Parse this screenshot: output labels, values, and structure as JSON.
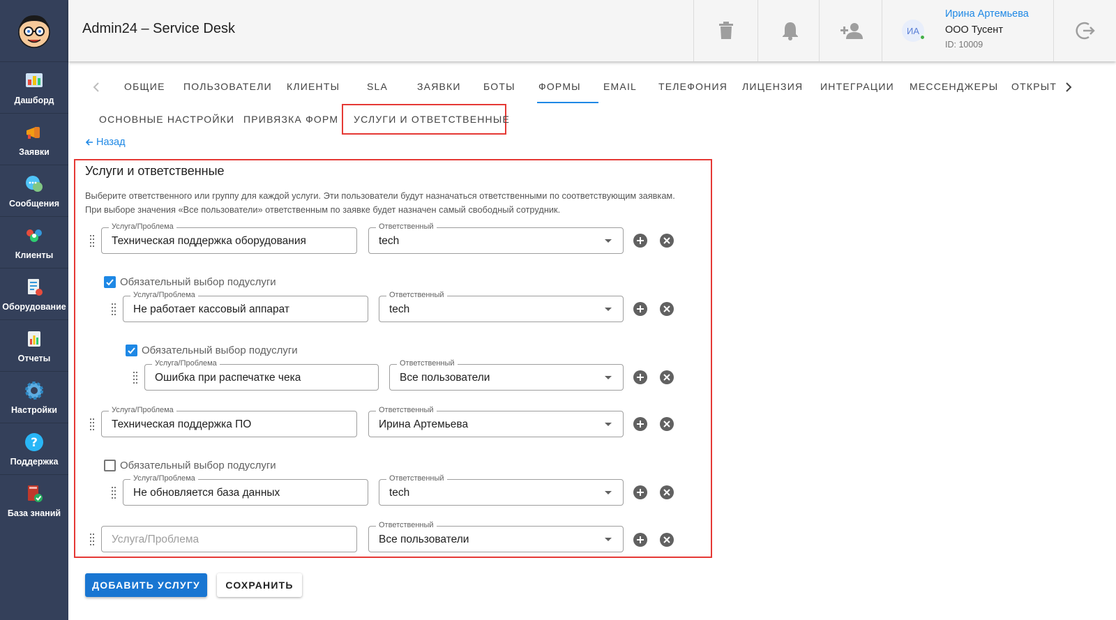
{
  "header": {
    "title": "Admin24 – Service Desk",
    "user": {
      "initials": "ИА",
      "name": "Ирина Артемьева",
      "org": "ООО Тусент",
      "id": "ID: 10009"
    }
  },
  "sidebar": {
    "items": [
      {
        "label": "Дашборд",
        "icon": "dashboard-icon"
      },
      {
        "label": "Заявки",
        "icon": "megaphone-icon"
      },
      {
        "label": "Сообщения",
        "icon": "chat-icon"
      },
      {
        "label": "Клиенты",
        "icon": "clients-icon"
      },
      {
        "label": "Оборудование",
        "icon": "equipment-icon"
      },
      {
        "label": "Отчеты",
        "icon": "report-icon"
      },
      {
        "label": "Настройки",
        "icon": "gear-icon"
      },
      {
        "label": "Поддержка",
        "icon": "help-icon"
      },
      {
        "label": "База знаний",
        "icon": "knowledge-book-icon"
      }
    ]
  },
  "tabs": [
    "ОБЩИЕ",
    "ПОЛЬЗОВАТЕЛИ",
    "КЛИЕНТЫ",
    "SLA",
    "ЗАЯВКИ",
    "БОТЫ",
    "ФОРМЫ",
    "EMAIL",
    "ТЕЛЕФОНИЯ",
    "ЛИЦЕНЗИЯ",
    "ИНТЕГРАЦИИ",
    "МЕССЕНДЖЕРЫ",
    "ОТКРЫТ"
  ],
  "active_tab": "ФОРМЫ",
  "subtabs": [
    "ОСНОВНЫЕ НАСТРОЙКИ",
    "ПРИВЯЗКА ФОРМ",
    "УСЛУГИ И ОТВЕТСТВЕННЫЕ"
  ],
  "active_subtab": "УСЛУГИ И ОТВЕТСТВЕННЫЕ",
  "back_label": "Назад",
  "card": {
    "title": "Услуги и ответственные",
    "description": "Выберите ответственного или группу для каждой услуги. Эти пользователи будут назначаться ответственными по соответствующим заявкам. При выборе значения «Все пользователи» ответственным по заявке будет назначен самый свободный сотрудник."
  },
  "labels": {
    "service": "Услуга/Проблема",
    "responsible": "Ответственный",
    "required_sub": "Обязательный выбор подуслуги"
  },
  "rows": [
    {
      "service": "Техническая поддержка оборудования",
      "responsible": "tech"
    },
    {
      "service": "Не работает кассовый аппарат",
      "responsible": "tech"
    },
    {
      "service": "Ошибка при распечатке чека",
      "responsible": "Все пользователи"
    },
    {
      "service": "Техническая поддержка ПО",
      "responsible": "Ирина Артемьева"
    },
    {
      "service": "Не обновляется база данных",
      "responsible": "tech"
    },
    {
      "service": "",
      "service_placeholder": "Услуга/Проблема",
      "responsible": "Все пользователи"
    }
  ],
  "checks": [
    {
      "checked": true
    },
    {
      "checked": true
    },
    {
      "checked": false
    }
  ],
  "buttons": {
    "add_service": "ДОБАВИТЬ УСЛУГУ",
    "save": "СОХРАНИТЬ"
  },
  "colors": {
    "accent": "#1e88e5",
    "sidebar": "#34405a",
    "highlight": "#e53935"
  }
}
